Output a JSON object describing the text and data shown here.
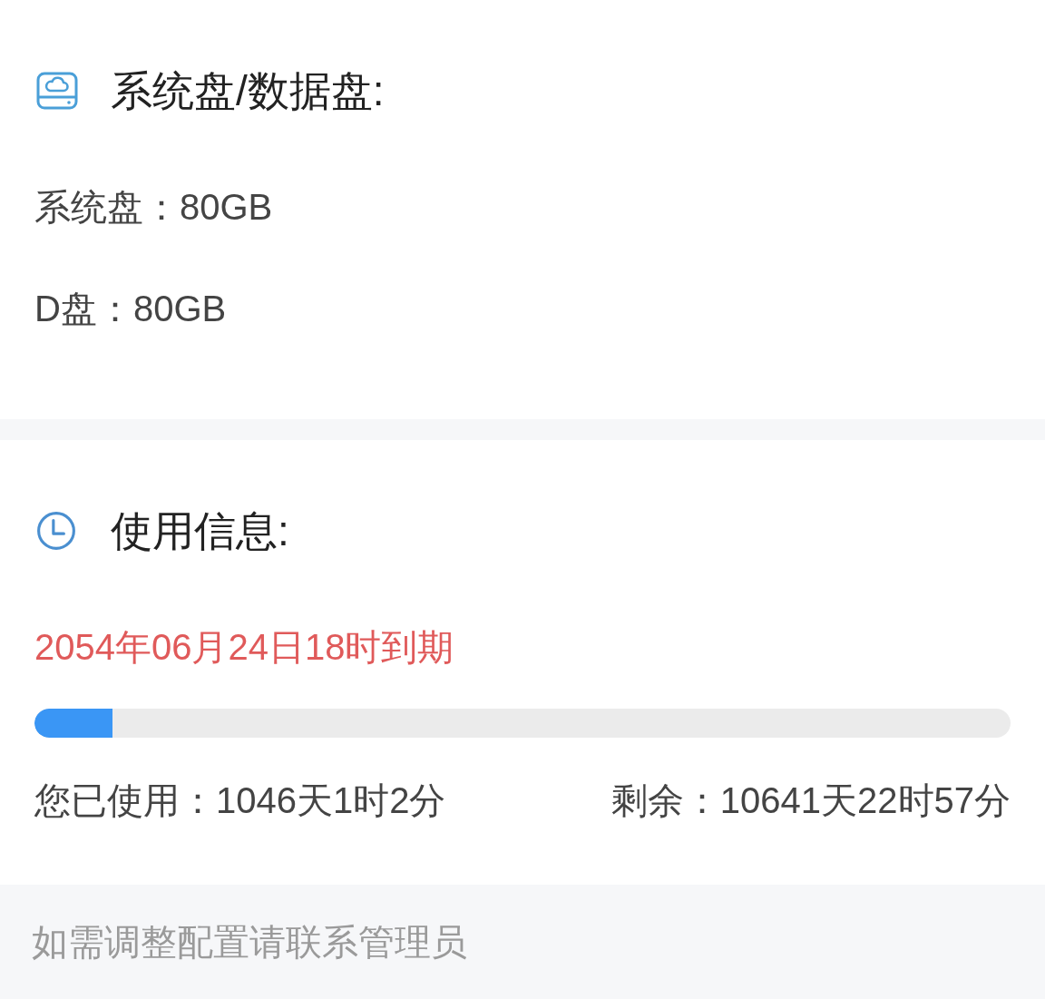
{
  "sections": [
    {
      "kind": "storage",
      "title": "系统盘/数据盘:",
      "lines": [
        "系统盘：80GB",
        "D盘：80GB"
      ]
    },
    {
      "kind": "usage",
      "title": "使用信息:",
      "expiry": "2054年06月24日18时到期",
      "progress": {
        "level": 0.08
      },
      "used": "您已使用：1046天1时2分",
      "remaining": "剩余：10641天22时57分"
    }
  ],
  "footer": {
    "note": "如需调整配置请联系管理员"
  }
}
